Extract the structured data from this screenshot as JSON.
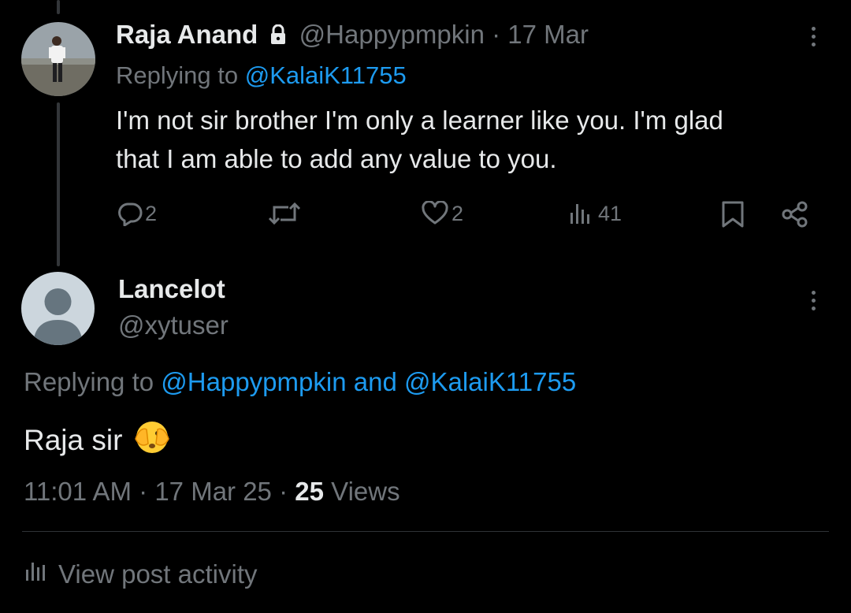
{
  "reply_tweet": {
    "author_name": "Raja Anand",
    "handle": "@Happypmpkin",
    "separator": "·",
    "date": "17 Mar",
    "replying_label": "Replying to",
    "replying_to": "@KalaiK11755",
    "text_line1": "I'm not sir brother I'm only a learner like you. I'm glad",
    "text_line2": "that I am able to add any value to you.",
    "actions": {
      "replies": "2",
      "reposts": "",
      "likes": "2",
      "views": "41"
    },
    "icons": {
      "lock": "lock-icon",
      "more": "more-vertical-icon",
      "reply": "reply-icon",
      "repost": "repost-icon",
      "like": "heart-icon",
      "views": "bar-chart-icon",
      "bookmark": "bookmark-icon",
      "share": "share-icon"
    }
  },
  "main_tweet": {
    "author_name": "Lancelot",
    "handle": "@xytuser",
    "replying_label": "Replying to",
    "replying_to_1": "@Happypmpkin",
    "and": "and",
    "replying_to_2": "@KalaiK11755",
    "text": "Raja sir",
    "emoji": "🫣",
    "time": "11:01 AM",
    "dot1": "·",
    "date": "17 Mar 25",
    "dot2": "·",
    "views_count": "25",
    "views_label": "Views"
  },
  "activity": {
    "label": "View post activity",
    "icon": "bar-chart-icon"
  },
  "colors": {
    "background": "#000000",
    "primary_text": "#e7e9ea",
    "secondary_text": "#71767b",
    "link": "#1d9bf0",
    "divider": "#2f3336"
  }
}
